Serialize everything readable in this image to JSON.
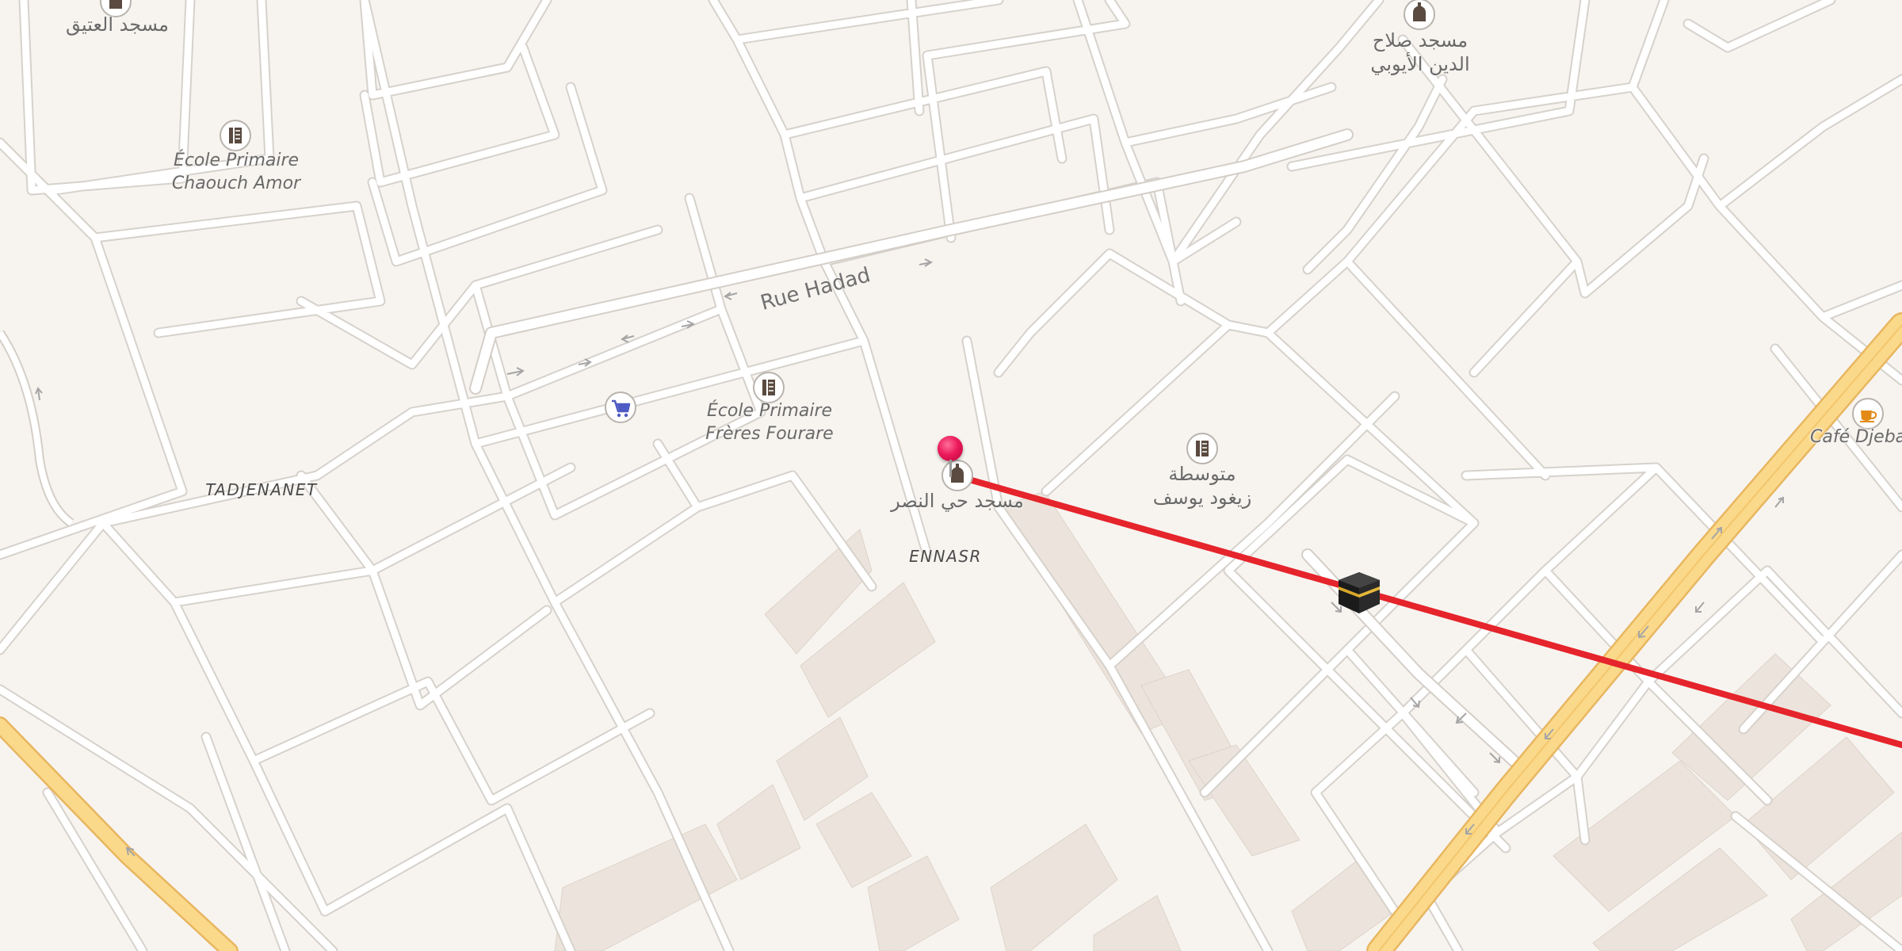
{
  "map": {
    "accent": "#e5242b",
    "road_color": "#ffffff",
    "background": "#f7f4f0",
    "highway_color": "#fbd98a",
    "building_color": "#ece4dc"
  },
  "labels": {
    "mosque_atiq": "مسجد العتيق",
    "school_chaouch_1": "École Primaire",
    "school_chaouch_2": "Chaouch Amor",
    "mosque_salah_1": "مسجد صلاح",
    "mosque_salah_2": "الدين الأيوبي",
    "street_hadad": "Rue Hadad",
    "school_fourare_1": "École Primaire",
    "school_fourare_2": "Frères Fourare",
    "mosque_nasr": "مسجد حي النصر",
    "middle_school_1": "متوسطة",
    "middle_school_2": "زيغود يوسف",
    "district_tadjenanet": "TADJENANET",
    "district_ennasr": "ENNASR",
    "cafe": "Café Djebal"
  },
  "icons": {
    "mosque": "mosque-icon",
    "school": "school-icon",
    "shop": "shopping-cart-icon",
    "cafe": "coffee-cup-icon",
    "pin": "location-pin-icon",
    "kaaba": "kaaba-icon"
  },
  "qibla": {
    "color": "#e5242b"
  }
}
